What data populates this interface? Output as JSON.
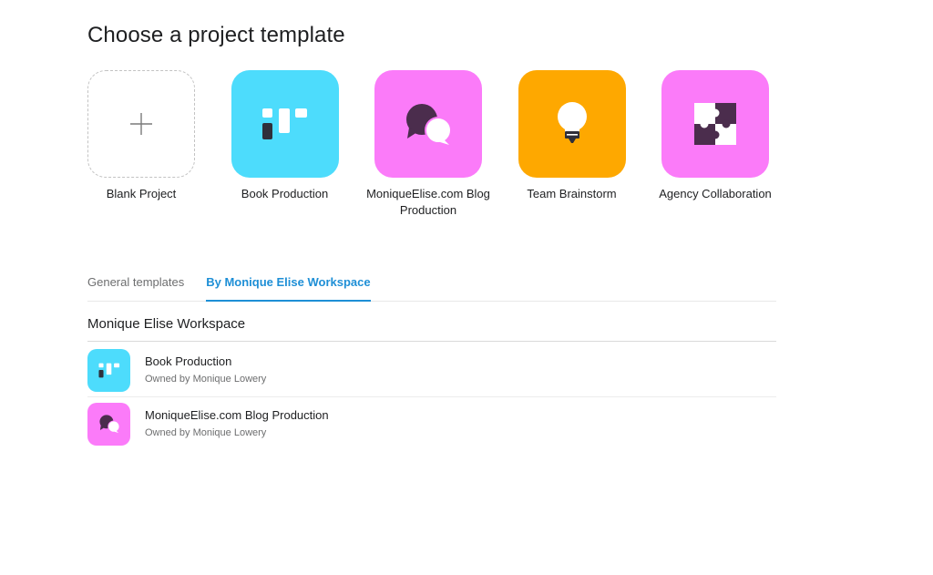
{
  "page_title": "Choose a project template",
  "colors": {
    "cyan": "#4ddcfc",
    "pink": "#fb7bf9",
    "orange": "#fea800",
    "dark_purple": "#4b2d4d",
    "accent_blue": "#1e8fd6"
  },
  "templates": [
    {
      "label": "Blank Project",
      "icon": "plus-icon"
    },
    {
      "label": "Book Production",
      "icon": "board-columns-icon"
    },
    {
      "label": "MoniqueElise.com Blog Production",
      "icon": "speech-bubbles-icon"
    },
    {
      "label": "Team Brainstorm",
      "icon": "lightbulb-icon"
    },
    {
      "label": "Agency Collaboration",
      "icon": "puzzle-icon"
    }
  ],
  "tabs": [
    {
      "label": "General templates",
      "active": false
    },
    {
      "label": "By Monique Elise Workspace",
      "active": true
    }
  ],
  "workspace": {
    "title": "Monique Elise Workspace",
    "items": [
      {
        "title": "Book Production",
        "owner": "Owned by Monique Lowery",
        "icon": "board-columns-icon"
      },
      {
        "title": "MoniqueElise.com Blog Production",
        "owner": "Owned by Monique Lowery",
        "icon": "speech-bubbles-icon"
      }
    ]
  }
}
